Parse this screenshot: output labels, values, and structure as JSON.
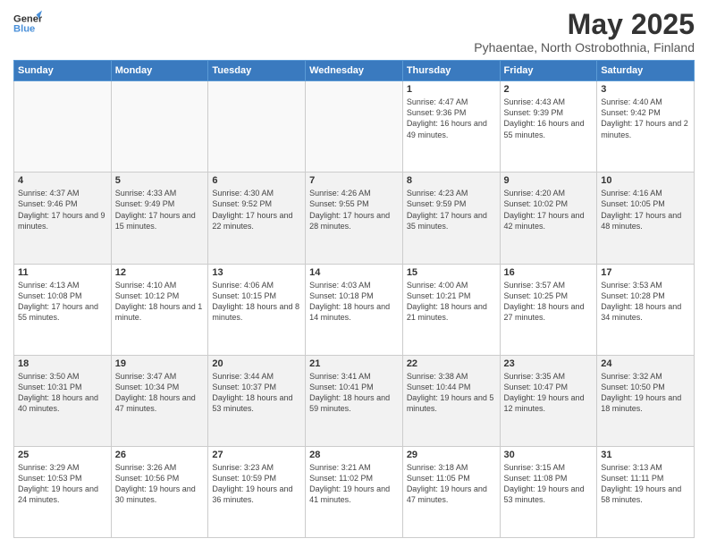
{
  "logo": {
    "line1": "General",
    "line2": "Blue"
  },
  "title": "May 2025",
  "subtitle": "Pyhaentae, North Ostrobothnia, Finland",
  "days_of_week": [
    "Sunday",
    "Monday",
    "Tuesday",
    "Wednesday",
    "Thursday",
    "Friday",
    "Saturday"
  ],
  "weeks": [
    [
      {
        "day": "",
        "info": ""
      },
      {
        "day": "",
        "info": ""
      },
      {
        "day": "",
        "info": ""
      },
      {
        "day": "",
        "info": ""
      },
      {
        "day": "1",
        "info": "Sunrise: 4:47 AM\nSunset: 9:36 PM\nDaylight: 16 hours\nand 49 minutes."
      },
      {
        "day": "2",
        "info": "Sunrise: 4:43 AM\nSunset: 9:39 PM\nDaylight: 16 hours\nand 55 minutes."
      },
      {
        "day": "3",
        "info": "Sunrise: 4:40 AM\nSunset: 9:42 PM\nDaylight: 17 hours\nand 2 minutes."
      }
    ],
    [
      {
        "day": "4",
        "info": "Sunrise: 4:37 AM\nSunset: 9:46 PM\nDaylight: 17 hours\nand 9 minutes."
      },
      {
        "day": "5",
        "info": "Sunrise: 4:33 AM\nSunset: 9:49 PM\nDaylight: 17 hours\nand 15 minutes."
      },
      {
        "day": "6",
        "info": "Sunrise: 4:30 AM\nSunset: 9:52 PM\nDaylight: 17 hours\nand 22 minutes."
      },
      {
        "day": "7",
        "info": "Sunrise: 4:26 AM\nSunset: 9:55 PM\nDaylight: 17 hours\nand 28 minutes."
      },
      {
        "day": "8",
        "info": "Sunrise: 4:23 AM\nSunset: 9:59 PM\nDaylight: 17 hours\nand 35 minutes."
      },
      {
        "day": "9",
        "info": "Sunrise: 4:20 AM\nSunset: 10:02 PM\nDaylight: 17 hours\nand 42 minutes."
      },
      {
        "day": "10",
        "info": "Sunrise: 4:16 AM\nSunset: 10:05 PM\nDaylight: 17 hours\nand 48 minutes."
      }
    ],
    [
      {
        "day": "11",
        "info": "Sunrise: 4:13 AM\nSunset: 10:08 PM\nDaylight: 17 hours\nand 55 minutes."
      },
      {
        "day": "12",
        "info": "Sunrise: 4:10 AM\nSunset: 10:12 PM\nDaylight: 18 hours\nand 1 minute."
      },
      {
        "day": "13",
        "info": "Sunrise: 4:06 AM\nSunset: 10:15 PM\nDaylight: 18 hours\nand 8 minutes."
      },
      {
        "day": "14",
        "info": "Sunrise: 4:03 AM\nSunset: 10:18 PM\nDaylight: 18 hours\nand 14 minutes."
      },
      {
        "day": "15",
        "info": "Sunrise: 4:00 AM\nSunset: 10:21 PM\nDaylight: 18 hours\nand 21 minutes."
      },
      {
        "day": "16",
        "info": "Sunrise: 3:57 AM\nSunset: 10:25 PM\nDaylight: 18 hours\nand 27 minutes."
      },
      {
        "day": "17",
        "info": "Sunrise: 3:53 AM\nSunset: 10:28 PM\nDaylight: 18 hours\nand 34 minutes."
      }
    ],
    [
      {
        "day": "18",
        "info": "Sunrise: 3:50 AM\nSunset: 10:31 PM\nDaylight: 18 hours\nand 40 minutes."
      },
      {
        "day": "19",
        "info": "Sunrise: 3:47 AM\nSunset: 10:34 PM\nDaylight: 18 hours\nand 47 minutes."
      },
      {
        "day": "20",
        "info": "Sunrise: 3:44 AM\nSunset: 10:37 PM\nDaylight: 18 hours\nand 53 minutes."
      },
      {
        "day": "21",
        "info": "Sunrise: 3:41 AM\nSunset: 10:41 PM\nDaylight: 18 hours\nand 59 minutes."
      },
      {
        "day": "22",
        "info": "Sunrise: 3:38 AM\nSunset: 10:44 PM\nDaylight: 19 hours\nand 5 minutes."
      },
      {
        "day": "23",
        "info": "Sunrise: 3:35 AM\nSunset: 10:47 PM\nDaylight: 19 hours\nand 12 minutes."
      },
      {
        "day": "24",
        "info": "Sunrise: 3:32 AM\nSunset: 10:50 PM\nDaylight: 19 hours\nand 18 minutes."
      }
    ],
    [
      {
        "day": "25",
        "info": "Sunrise: 3:29 AM\nSunset: 10:53 PM\nDaylight: 19 hours\nand 24 minutes."
      },
      {
        "day": "26",
        "info": "Sunrise: 3:26 AM\nSunset: 10:56 PM\nDaylight: 19 hours\nand 30 minutes."
      },
      {
        "day": "27",
        "info": "Sunrise: 3:23 AM\nSunset: 10:59 PM\nDaylight: 19 hours\nand 36 minutes."
      },
      {
        "day": "28",
        "info": "Sunrise: 3:21 AM\nSunset: 11:02 PM\nDaylight: 19 hours\nand 41 minutes."
      },
      {
        "day": "29",
        "info": "Sunrise: 3:18 AM\nSunset: 11:05 PM\nDaylight: 19 hours\nand 47 minutes."
      },
      {
        "day": "30",
        "info": "Sunrise: 3:15 AM\nSunset: 11:08 PM\nDaylight: 19 hours\nand 53 minutes."
      },
      {
        "day": "31",
        "info": "Sunrise: 3:13 AM\nSunset: 11:11 PM\nDaylight: 19 hours\nand 58 minutes."
      }
    ]
  ]
}
